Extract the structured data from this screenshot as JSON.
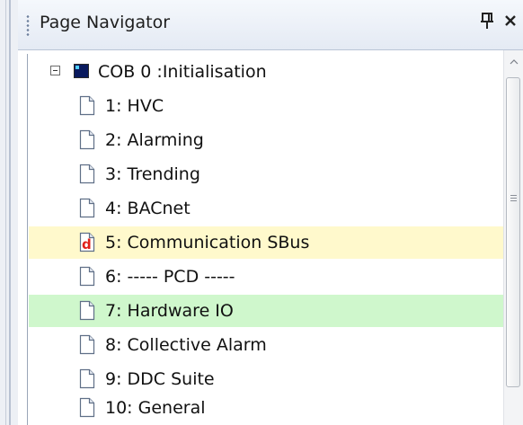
{
  "panel": {
    "title": "Page Navigator",
    "pin_glyph": "q",
    "close_glyph": "×"
  },
  "tree": {
    "root": {
      "label": "COB 0 :Initialisation",
      "icon": "cob-icon",
      "expanded": true
    },
    "pages": [
      {
        "label": "1: HVC",
        "icon": "page-icon"
      },
      {
        "label": "2: Alarming",
        "icon": "page-icon"
      },
      {
        "label": "3: Trending",
        "icon": "page-icon"
      },
      {
        "label": "4: BACnet",
        "icon": "page-icon"
      },
      {
        "label": "5: Communication SBus",
        "icon": "d-page-icon",
        "highlight": "#fff9cc"
      },
      {
        "label": "6: ----- PCD -----",
        "icon": "page-icon"
      },
      {
        "label": "7: Hardware IO",
        "icon": "page-icon",
        "highlight": "#cff7cc"
      },
      {
        "label": "8: Collective Alarm",
        "icon": "page-icon"
      },
      {
        "label": "9: DDC Suite",
        "icon": "page-icon"
      },
      {
        "label": "10: General",
        "icon": "page-icon"
      }
    ]
  },
  "colors": {
    "yellow_highlight": "#fff9cc",
    "green_highlight": "#cff7cc",
    "d_icon_red": "#e0201a"
  }
}
